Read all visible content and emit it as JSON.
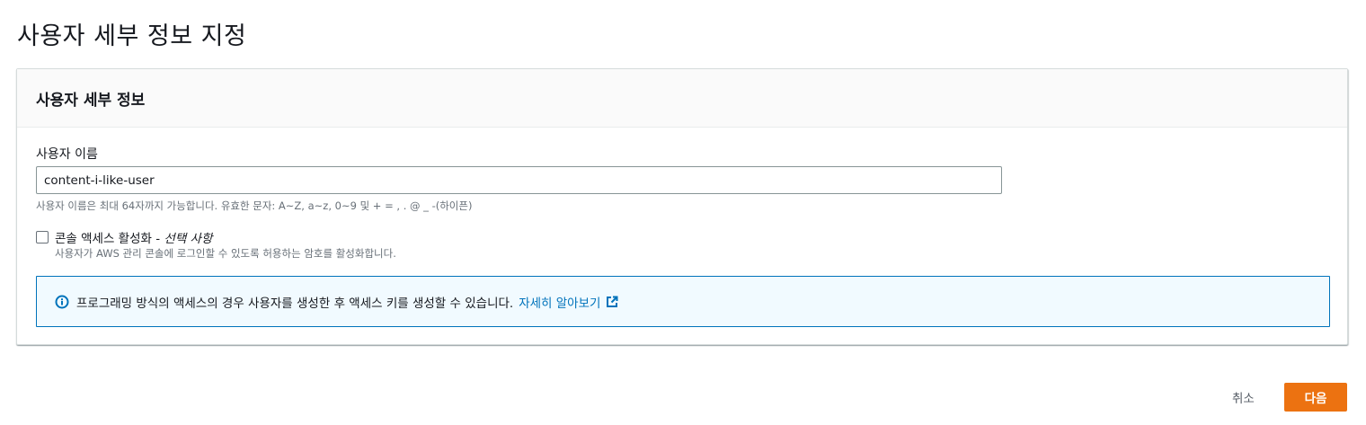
{
  "page": {
    "title": "사용자 세부 정보 지정"
  },
  "panel": {
    "title": "사용자 세부 정보",
    "username": {
      "label": "사용자 이름",
      "value": "content-i-like-user",
      "hint": "사용자 이름은 최대 64자까지 가능합니다. 유효한 문자: A~Z, a~z, 0~9 및 + = , . @ _ -(하이픈)"
    },
    "console_access": {
      "label": "콘솔 액세스 활성화 -",
      "optional": "선택 사항",
      "checked": false,
      "description": "사용자가 AWS 관리 콘솔에 로그인할 수 있도록 허용하는 암호를 활성화합니다."
    },
    "info_alert": {
      "icon": "info-icon",
      "text": "프로그래밍 방식의 액세스의 경우 사용자를 생성한 후 액세스 키를 생성할 수 있습니다.",
      "link_text": "자세히 알아보기",
      "link_icon": "external-link-icon"
    }
  },
  "footer": {
    "cancel_label": "취소",
    "next_label": "다음"
  },
  "colors": {
    "primary_button": "#ec7211",
    "link": "#0073bb",
    "info_border": "#0073bb",
    "info_background": "#f1faff"
  }
}
